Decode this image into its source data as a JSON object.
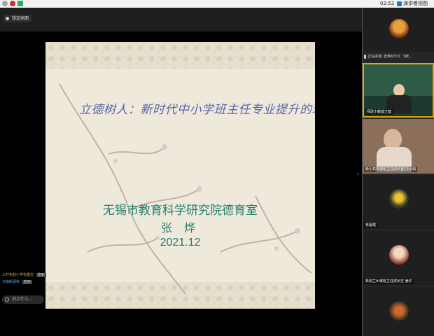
{
  "topbar": {
    "time": "02:52",
    "view_label": "演讲者视图"
  },
  "header": {
    "record_label": "锁定画面"
  },
  "slide": {
    "title": "立德树人：新时代中小学班主任专业提升的现实站位与实践指向",
    "org": "无锡市教育科学研究院德育室",
    "speaker": "张  烨",
    "date": "2021.12"
  },
  "chat": {
    "line1_name": "三井实验小学张露吉",
    "line1_tag": "签到",
    "line2_name": "河海新源校",
    "line2_tag": "签到",
    "comment_placeholder": "说点什么..."
  },
  "participants": {
    "speaking_text": "正在讲话: 张烨6703; 飞跃...",
    "tile2_name": "师改小教孤王健",
    "tile3_name": "新小高周谋班主任成长室(冯小娟",
    "tile4_name": "林嘉霞",
    "tile5_name": "新加兰州谋班主任成长空 姜红"
  }
}
